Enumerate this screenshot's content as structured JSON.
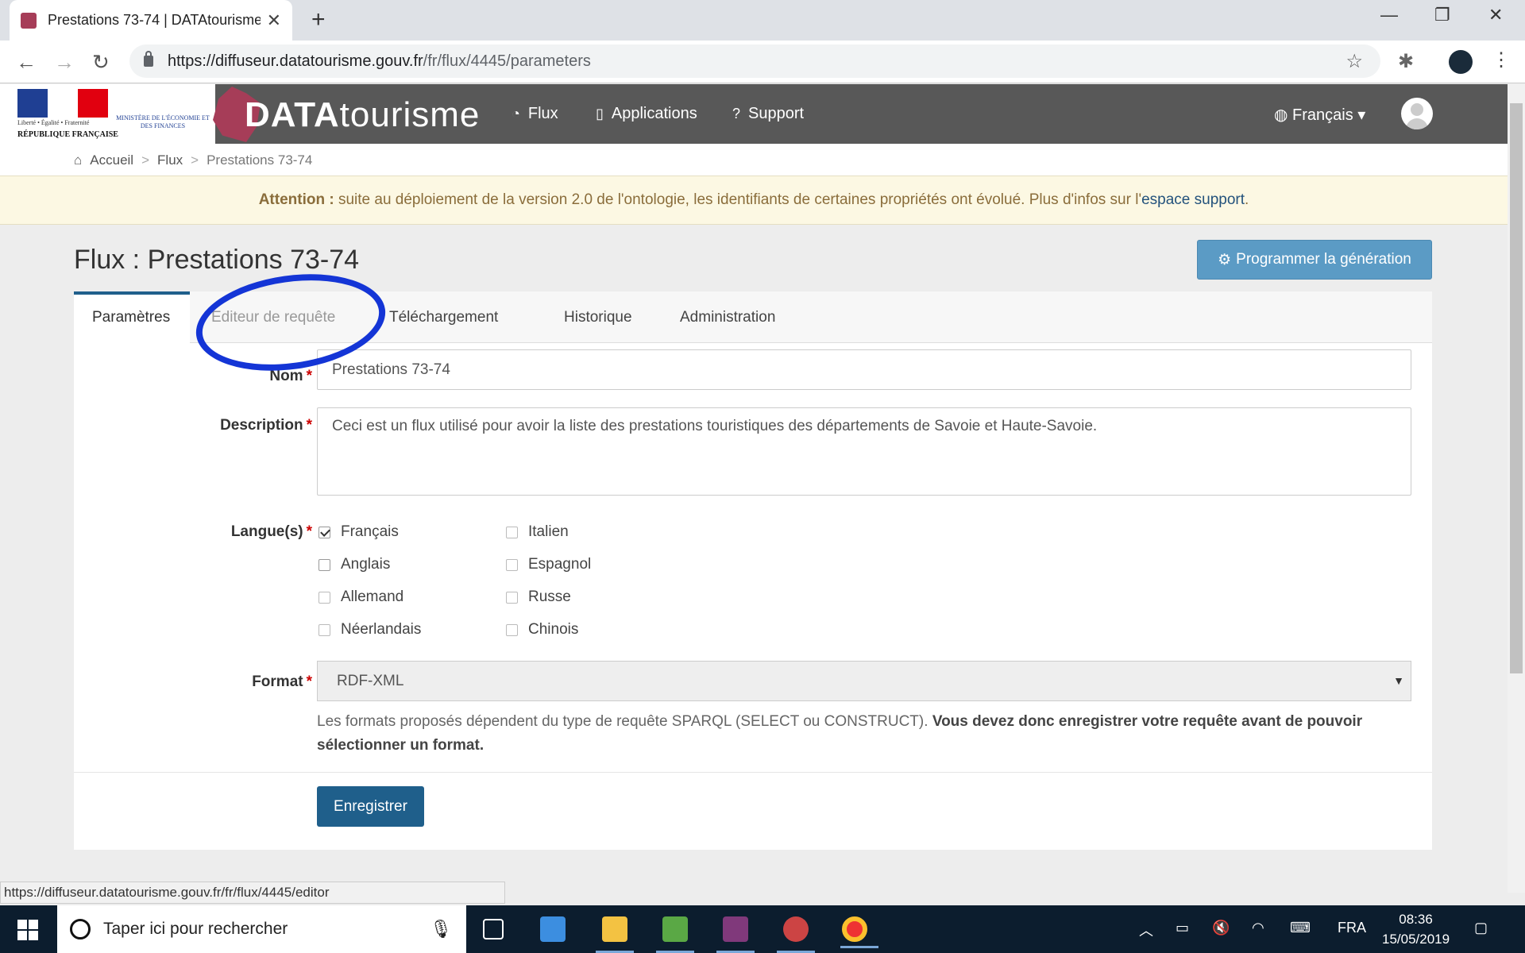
{
  "browser": {
    "tab_title": "Prestations 73-74 | DATAtourisme",
    "url_host": "https://diffuseur.datatourisme.gouv.fr",
    "url_path": "/fr/flux/4445/parameters",
    "status_url": "https://diffuseur.datatourisme.gouv.fr/fr/flux/4445/editor"
  },
  "site": {
    "rf_motto": "Liberté • Égalité • Fraternité",
    "rf_name": "RÉPUBLIQUE FRANÇAISE",
    "ministry": "MINISTÈRE DE L'ÉCONOMIE ET DES FINANCES",
    "brand_bold": "DATA",
    "brand_thin": "tourisme",
    "nav": [
      {
        "label": "Flux",
        "icon": "rss-icon"
      },
      {
        "label": "Applications",
        "icon": "mobile-icon"
      },
      {
        "label": "Support",
        "icon": "question-circle-icon"
      }
    ],
    "language": "Français"
  },
  "breadcrumb": [
    "Accueil",
    "Flux",
    "Prestations 73-74"
  ],
  "alert": {
    "bold": "Attention :",
    "text": " suite au déploiement de la version 2.0 de l'ontologie, les identifiants de certaines propriétés ont évolué. Plus d'infos sur l'",
    "link": "espace support",
    "end": "."
  },
  "page": {
    "title": "Flux : Prestations 73-74",
    "generate_button": "Programmer la génération",
    "tabs": [
      "Paramètres",
      "Editeur de requête",
      "Téléchargement",
      "Historique",
      "Administration"
    ]
  },
  "form": {
    "name_label": "Nom",
    "name_value": "Prestations 73-74",
    "description_label": "Description",
    "description_value": "Ceci est un flux utilisé pour avoir la liste des prestations touristiques des départements de Savoie et Haute-Savoie.",
    "languages_label": "Langue(s)",
    "languages": [
      {
        "label": "Français",
        "checked": true
      },
      {
        "label": "Italien",
        "checked": false
      },
      {
        "label": "Anglais",
        "checked": false
      },
      {
        "label": "Espagnol",
        "checked": false
      },
      {
        "label": "Allemand",
        "checked": false
      },
      {
        "label": "Russe",
        "checked": false
      },
      {
        "label": "Néerlandais",
        "checked": false
      },
      {
        "label": "Chinois",
        "checked": false
      }
    ],
    "format_label": "Format",
    "format_value": "RDF-XML",
    "help_text": "Les formats proposés dépendent du type de requête SPARQL (SELECT ou CONSTRUCT). ",
    "help_bold": "Vous devez donc enregistrer votre requête avant de pouvoir sélectionner un format.",
    "save_button": "Enregistrer",
    "required_mark": "*"
  },
  "taskbar": {
    "search_placeholder": "Taper ici pour rechercher",
    "lang": "FRA",
    "time": "08:36",
    "date": "15/05/2019"
  },
  "colors": {
    "navbar": "#585858",
    "primary": "#1f5f8b",
    "generate": "#5b9bc5",
    "annotation": "#1435d6",
    "alert_bg": "#fcf8e3"
  }
}
